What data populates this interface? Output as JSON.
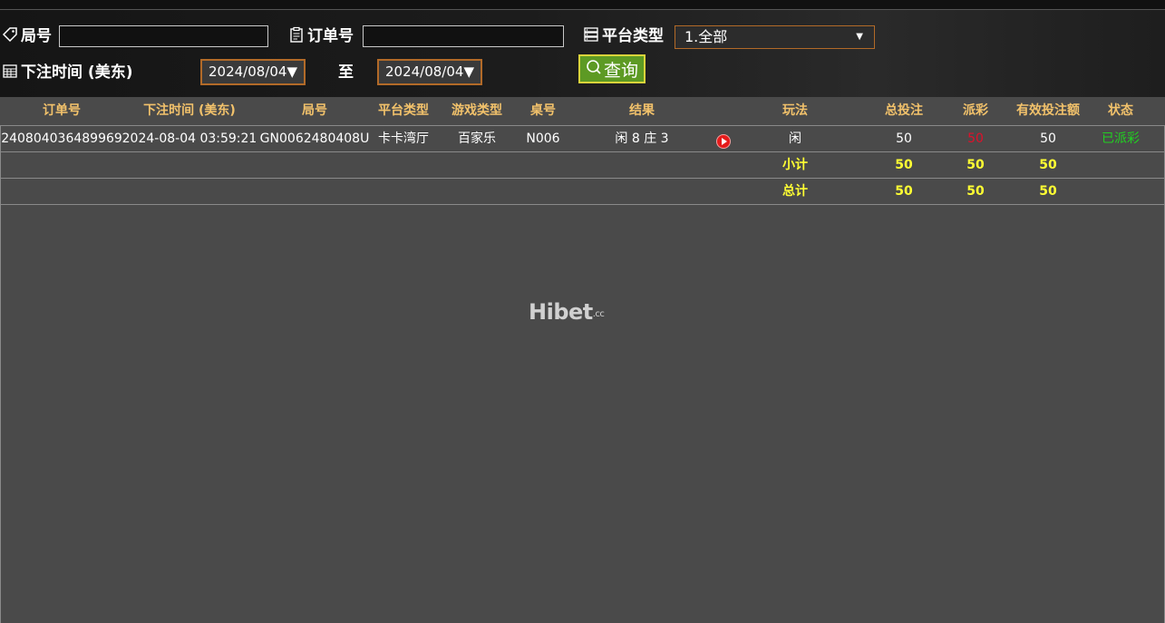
{
  "filters": {
    "round_label": "局号",
    "order_label": "订单号",
    "platform_label": "平台类型",
    "platform_selected": "1.全部",
    "time_label": "下注时间 (美东)",
    "date_from": "2024/08/04",
    "to_label": "至",
    "date_to": "2024/08/04",
    "query_label": "查询",
    "round_value": "",
    "order_value": ""
  },
  "table": {
    "headers": [
      "订单号",
      "下注时间 (美东)",
      "局号",
      "平台类型",
      "游戏类型",
      "桌号",
      "结果",
      "玩法",
      "总投注",
      "派彩",
      "有效投注额",
      "状态"
    ],
    "rows": [
      {
        "order_no": "240804036489969",
        "bet_time": "2024-08-04 03:59:21",
        "round_no": "GN0062480408U",
        "platform": "卡卡湾厅",
        "game_type": "百家乐",
        "table_no": "N006",
        "result": "闲 8 庄 3",
        "play": "闲",
        "total_bet": "50",
        "payout": "50",
        "valid_bet": "50",
        "status": "已派彩"
      }
    ],
    "subtotal": {
      "label": "小计",
      "total_bet": "50",
      "payout": "50",
      "valid_bet": "50"
    },
    "grandtotal": {
      "label": "总计",
      "total_bet": "50",
      "payout": "50",
      "valid_bet": "50"
    }
  },
  "watermark": {
    "text": "Hibet",
    "suffix": ".cc"
  },
  "colors": {
    "header_text": "#f2c26b",
    "total_text": "#ffff33",
    "payout_red": "#e0102a",
    "status_green": "#21d021",
    "accent_border": "#b26a28",
    "query_bg": "#5d9a24"
  }
}
